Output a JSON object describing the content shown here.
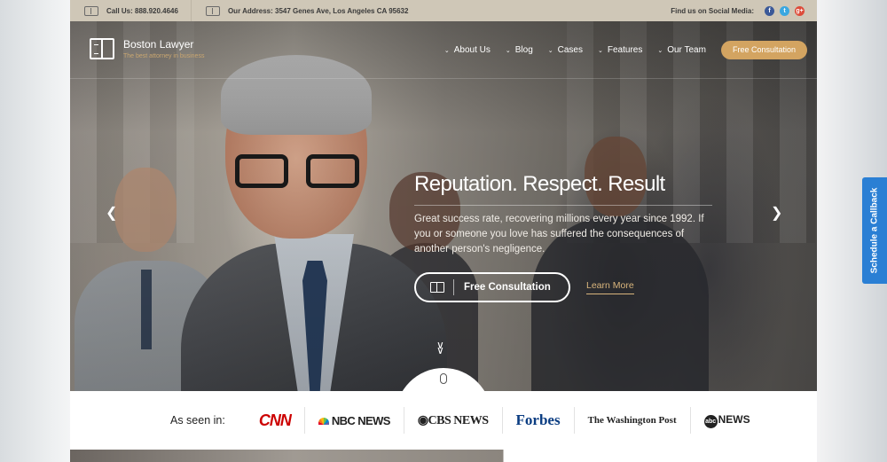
{
  "topbar": {
    "phone": "Call Us: 888.920.4646",
    "address": "Our Address: 3547 Genes Ave, Los Angeles CA 95632",
    "social_label": "Find us on Social Media:",
    "social": [
      "f",
      "t",
      "g+"
    ]
  },
  "brand": {
    "name": "Boston Lawyer",
    "tagline": "The best attorney in business"
  },
  "nav": {
    "items": [
      "About Us",
      "Blog",
      "Cases",
      "Features",
      "Our Team"
    ],
    "cta": "Free Consultation"
  },
  "hero": {
    "title": "Reputation. Respect. Result",
    "text": "Great success rate, recovering millions every year since 1992. If you or someone you love has suffered the consequences of another person's negligence.",
    "primary_button": "Free Consultation",
    "secondary_link": "Learn More"
  },
  "seen_in": {
    "label": "As seen in:",
    "logos": [
      "CNN",
      "NBC NEWS",
      "CBS NEWS",
      "Forbes",
      "The Washington Post",
      "NEWS"
    ],
    "abc_mark": "abc"
  },
  "side_tab": "Schedule a Callback",
  "colors": {
    "accent": "#d3a461",
    "topbar": "#cfc7b7",
    "callback": "#2a7fd4"
  }
}
